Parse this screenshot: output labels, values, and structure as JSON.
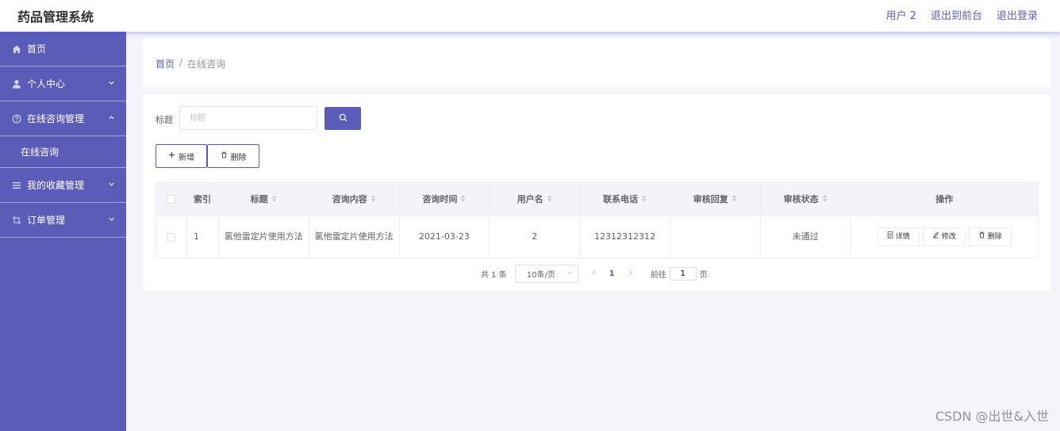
{
  "app": {
    "title": "药品管理系统"
  },
  "topbar": {
    "user": "用户 2",
    "to_front": "退出到前台",
    "logout": "退出登录"
  },
  "sidebar": {
    "items": [
      {
        "label": "首页",
        "icon": "home-icon"
      },
      {
        "label": "个人中心",
        "icon": "user-icon"
      },
      {
        "label": "在线咨询管理",
        "icon": "help-circle-icon",
        "expanded": true,
        "children": [
          {
            "label": "在线咨询"
          }
        ]
      },
      {
        "label": "我的收藏管理",
        "icon": "list-icon"
      },
      {
        "label": "订单管理",
        "icon": "crop-icon"
      }
    ]
  },
  "breadcrumb": {
    "home": "首页",
    "separator": "/",
    "current": "在线咨询"
  },
  "search": {
    "label": "标题",
    "placeholder": "标题"
  },
  "actions": {
    "add": "新增",
    "delete": "删除"
  },
  "table": {
    "columns": [
      "索引",
      "标题",
      "咨询内容",
      "咨询时间",
      "用户名",
      "联系电话",
      "审核回复",
      "审核状态",
      "操作"
    ],
    "rows": [
      {
        "index": "1",
        "title": "氯他雷定片使用方法",
        "content": "氯他雷定片使用方法",
        "time": "2021-03-23",
        "username": "2",
        "phone": "12312312312",
        "reply": "",
        "status": "未通过"
      }
    ],
    "row_actions": {
      "detail": "详情",
      "edit": "修改",
      "delete": "删除"
    }
  },
  "pagination": {
    "total": "共 1 条",
    "page_size": "10条/页",
    "current_page": "1",
    "goto_label": "前往",
    "goto_value": "1",
    "page_unit": "页"
  },
  "watermark": "CSDN @出世&入世",
  "colors": {
    "primary": "#5b5cb8",
    "background": "#f4f4fb"
  }
}
